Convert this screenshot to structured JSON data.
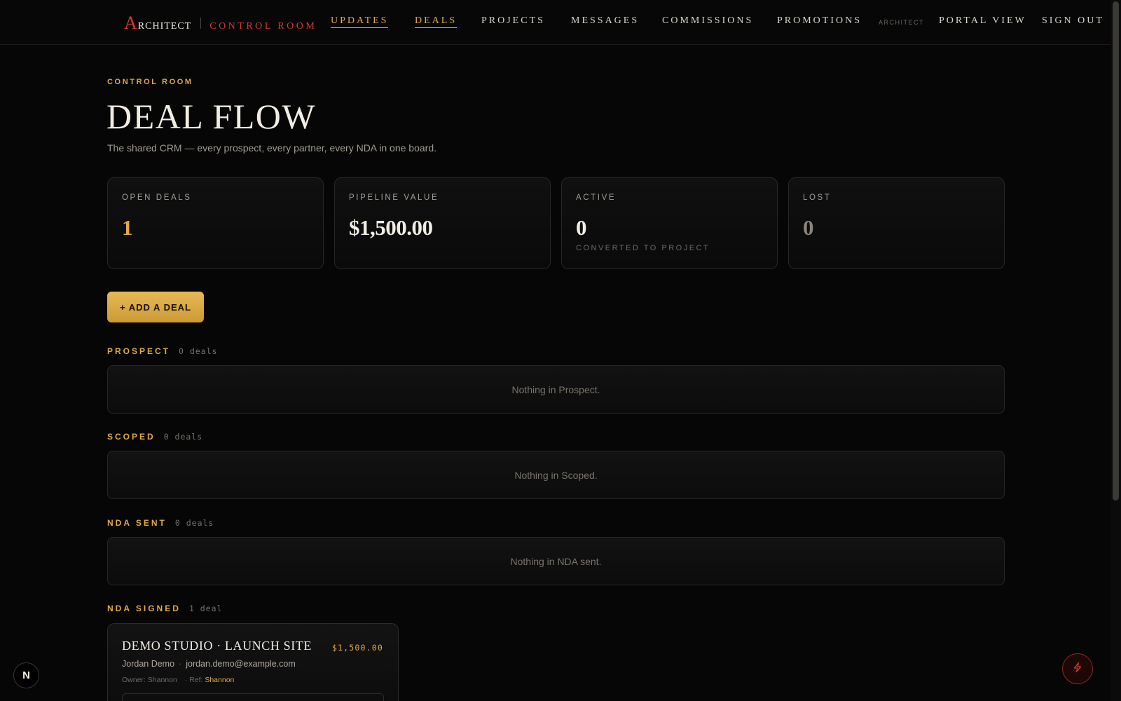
{
  "brand": {
    "logo_initial": "A",
    "logo_rest": "RCHITECT",
    "subtitle": "CONTROL ROOM"
  },
  "nav": {
    "items": [
      {
        "label": "UPDATES",
        "active": true
      },
      {
        "label": "DEALS",
        "active": true
      },
      {
        "label": "PROJECTS",
        "active": false
      },
      {
        "label": "MESSAGES",
        "active": false
      },
      {
        "label": "COMMISSIONS",
        "active": false
      },
      {
        "label": "PROMOTIONS",
        "active": false
      }
    ],
    "role": "ARCHITECT",
    "portal_view": "PORTAL VIEW",
    "sign_out": "SIGN OUT"
  },
  "header": {
    "eyebrow": "CONTROL ROOM",
    "title": "DEAL FLOW",
    "subtitle": "The shared CRM — every prospect, every partner, every NDA in one board."
  },
  "stats": [
    {
      "label": "OPEN DEALS",
      "value": "1",
      "note": "",
      "color": "#e0a94c"
    },
    {
      "label": "PIPELINE VALUE",
      "value": "$1,500.00",
      "note": "",
      "color": "#f2ede4"
    },
    {
      "label": "ACTIVE",
      "value": "0",
      "note": "CONVERTED TO PROJECT",
      "color": "#f2ede4"
    },
    {
      "label": "LOST",
      "value": "0",
      "note": "",
      "color": "#8a847c"
    }
  ],
  "add_deal_label": "+ ADD A DEAL",
  "stages": [
    {
      "name": "PROSPECT",
      "count": "0 deals",
      "empty_text": "Nothing in Prospect."
    },
    {
      "name": "SCOPED",
      "count": "0 deals",
      "empty_text": "Nothing in Scoped."
    },
    {
      "name": "NDA SENT",
      "count": "0 deals",
      "empty_text": "Nothing in NDA sent."
    },
    {
      "name": "NDA SIGNED",
      "count": "1 deal",
      "empty_text": ""
    }
  ],
  "deal": {
    "title": "DEMO STUDIO · LAUNCH SITE",
    "amount": "$1,500.00",
    "contact_name": "Jordan Demo",
    "separator": "·",
    "contact_email": "jordan.demo@example.com",
    "owner": "Owner: Shannon",
    "ref_label": "· Ref:",
    "ref_name": "Shannon"
  },
  "fab": {
    "left_initial": "N",
    "right_icon": "bolt-icon"
  },
  "colors": {
    "accent": "#e0a94c",
    "brand_red": "#d8382f",
    "background": "#060606"
  }
}
